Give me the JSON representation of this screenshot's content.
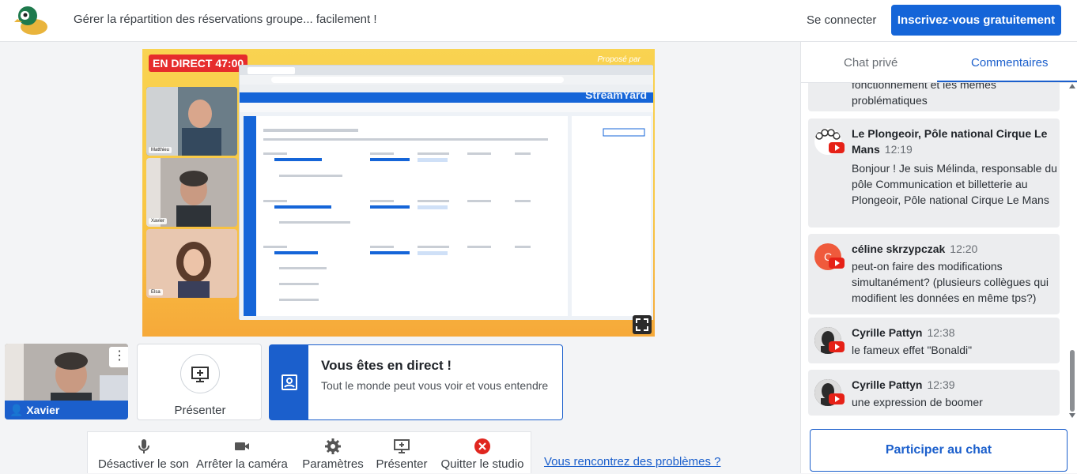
{
  "header": {
    "tagline": "Gérer la répartition des réservations groupe... facilement !",
    "login_label": "Se connecter",
    "signup_label": "Inscrivez-vous gratuitement"
  },
  "stage": {
    "live_badge": "EN DIRECT 47:00",
    "brand_small": "Proposé par",
    "brand_name": "StreamYard",
    "participants": [
      {
        "name": "Matthieu"
      },
      {
        "name": "Xavier"
      },
      {
        "name": "Elsa"
      }
    ]
  },
  "self_view": {
    "name": "Xavier"
  },
  "present_tile": {
    "label": "Présenter"
  },
  "live_card": {
    "title": "Vous êtes en direct !",
    "text": "Tout le monde peut vous voir et vous entendre"
  },
  "toolbar": {
    "mute": "Désactiver le son",
    "camera": "Arrêter la caméra",
    "settings": "Paramètres",
    "present": "Présenter",
    "quit": "Quitter le studio"
  },
  "help_link": "Vous rencontrez des problèmes ?",
  "chat": {
    "tab_private": "Chat privé",
    "tab_comments": "Commentaires",
    "partial_message": "fonctionnement et les mêmes problématiques",
    "messages": [
      {
        "author": "Le Plongeoir, Pôle national Cirque Le Mans",
        "time": "12:19",
        "text": "Bonjour ! Je suis Mélinda, responsable du pôle Communication et billetterie au Plongeoir, Pôle national Cirque Le Mans"
      },
      {
        "author": "céline skrzypczak",
        "time": "12:20",
        "initial": "C",
        "text": "peut-on faire des modifications simultanément? (plusieurs collègues qui modifient les données en même tps?)"
      },
      {
        "author": "Cyrille Pattyn",
        "time": "12:38",
        "text": "le fameux effet \"Bonaldi\""
      },
      {
        "author": "Cyrille Pattyn",
        "time": "12:39",
        "text": "une expression de boomer"
      }
    ],
    "join_label": "Participer au chat"
  },
  "colors": {
    "accent": "#1565d8",
    "live": "#e62c2c",
    "stage": "#f9c744"
  }
}
